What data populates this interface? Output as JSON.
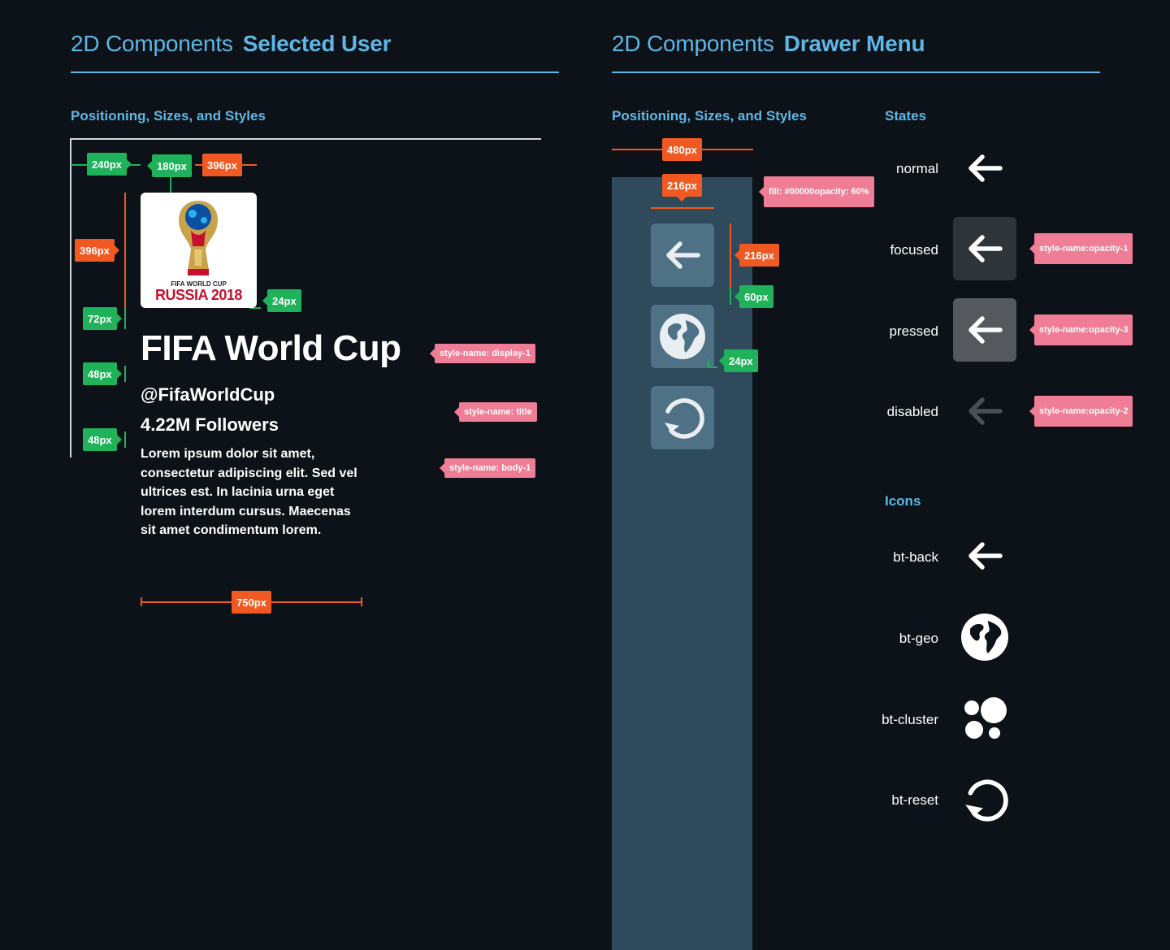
{
  "left": {
    "heading_light": "2D Components",
    "heading_bold": "Selected User",
    "subheading": "Positioning, Sizes, and Styles",
    "dims": {
      "d240": "240px",
      "d180": "180px",
      "d396a": "396px",
      "d396b": "396px",
      "d72": "72px",
      "d24": "24px",
      "d48a": "48px",
      "d48b": "48px",
      "d750": "750px"
    },
    "logo": {
      "line1": "FIFA WORLD CUP",
      "line2": "RUSSIA 2018",
      "colors": {
        "red": "#c8102e",
        "gold": "#c9a24c",
        "blue": "#0b4fa3"
      }
    },
    "user": {
      "name": "FIFA World Cup",
      "handle": "@FifaWorldCup",
      "followers": "4.22M Followers",
      "bio": "Lorem ipsum dolor sit amet, consectetur adipiscing elit. Sed vel ultrices est. In lacinia urna eget lorem interdum cursus. Maecenas sit amet condimentum lorem."
    },
    "styles": {
      "display": "style-name: display-1",
      "title": "style-name: title",
      "body": "style-name: body-1"
    }
  },
  "right": {
    "heading_light": "2D Components",
    "heading_bold": "Drawer Menu",
    "subheading": "Positioning, Sizes, and Styles",
    "dims": {
      "d480": "480px",
      "d216a": "216px",
      "d216b": "216px",
      "d60": "60px",
      "d24": "24px"
    },
    "fill_note_line1": "fill: #00000",
    "fill_note_line2": "opacity: 60%",
    "drawer_buttons": [
      {
        "icon": "arrow-left-icon"
      },
      {
        "icon": "globe-icon"
      },
      {
        "icon": "reset-icon"
      }
    ],
    "states_title": "States",
    "states": [
      {
        "label": "normal",
        "style_line1": "",
        "style_line2": ""
      },
      {
        "label": "focused",
        "style_line1": "style-name:",
        "style_line2": "opacity-1"
      },
      {
        "label": "pressed",
        "style_line1": "style-name:",
        "style_line2": "opacity-3"
      },
      {
        "label": "disabled",
        "style_line1": "style-name:",
        "style_line2": "opacity-2"
      }
    ],
    "icons_title": "Icons",
    "icons": [
      {
        "label": "bt-back",
        "icon": "arrow-left-icon"
      },
      {
        "label": "bt-geo",
        "icon": "globe-icon"
      },
      {
        "label": "bt-cluster",
        "icon": "cluster-icon"
      },
      {
        "label": "bt-reset",
        "icon": "reset-icon"
      }
    ]
  },
  "colors": {
    "background": "#0c1217",
    "accent": "#5eb7e5",
    "green_tag": "#1fb25a",
    "orange_tag": "#f05a22",
    "pink_tag": "#ee7d95",
    "drawer": "#2e4a5b",
    "drawer_button": "#4e7186",
    "focused": "#2f3439",
    "pressed": "#55595d"
  }
}
